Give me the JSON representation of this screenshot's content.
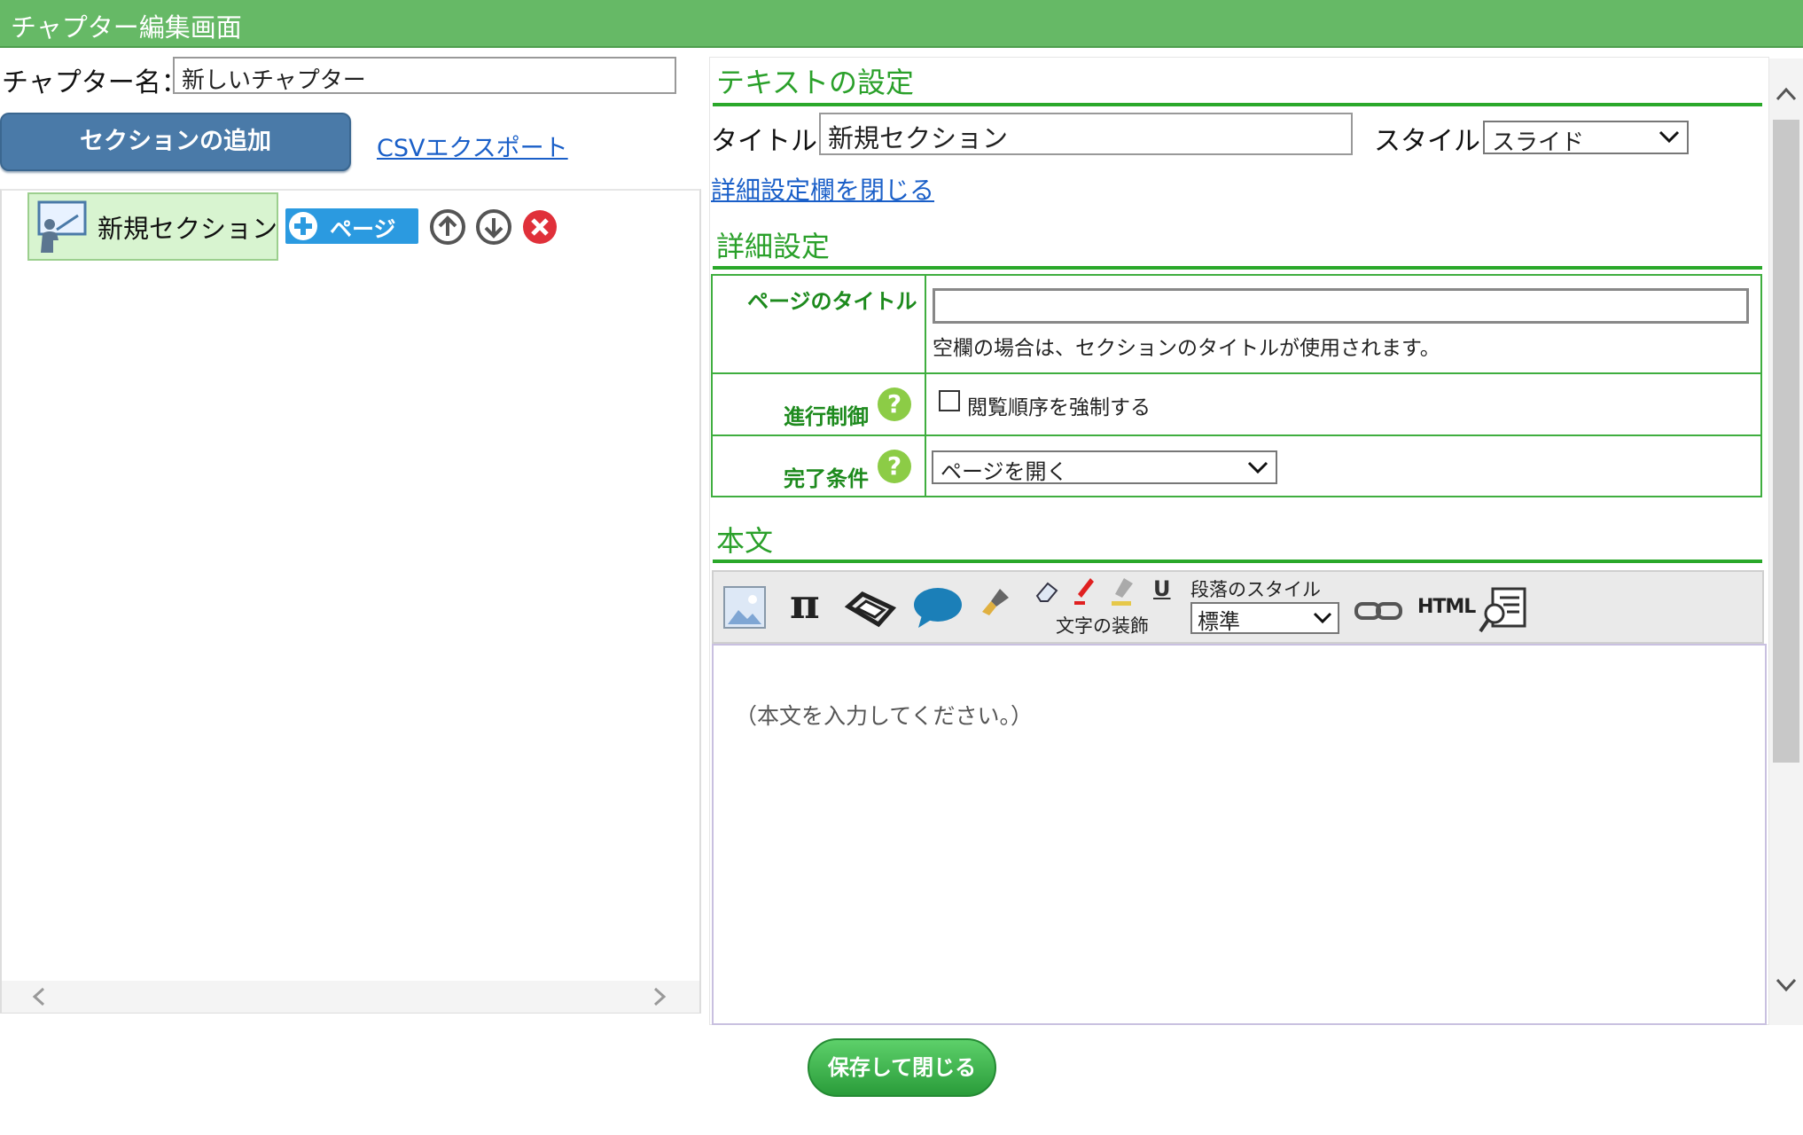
{
  "window": {
    "title": "チャプター編集画面"
  },
  "chapter": {
    "name_label": "チャプター名：",
    "name_value": "新しいチャプター"
  },
  "left": {
    "add_section_label": "セクションの追加",
    "csv_export_label": "CSVエクスポート",
    "tree": {
      "section_label": "新規セクション",
      "page_button_label": "ページ"
    }
  },
  "text_settings": {
    "heading": "テキストの設定",
    "title_label": "タイトル:",
    "title_value": "新規セクション",
    "style_label": "スタイル:",
    "style_value": "スライド",
    "collapse_link": "詳細設定欄を閉じる"
  },
  "detail": {
    "heading": "詳細設定",
    "page_title_label": "ページのタイトル",
    "page_title_value": "",
    "page_title_hint": "空欄の場合は、セクションのタイトルが使用されます。",
    "progress_label": "進行制御",
    "progress_checkbox_label": "閲覧順序を強制する",
    "progress_checked": false,
    "completion_label": "完了条件",
    "completion_value": "ページを開く",
    "help_glyph": "?"
  },
  "body": {
    "heading": "本文",
    "pi_glyph": "π",
    "underline_glyph": "U",
    "text_decoration_label": "文字の装飾",
    "paragraph_style_label": "段落のスタイル",
    "paragraph_style_value": "標準",
    "html_label": "HTML",
    "placeholder": "（本文を入力してください。）"
  },
  "footer": {
    "save_close_label": "保存して閉じる"
  },
  "colors": {
    "titlebar": "#66b966",
    "accent_green": "#2aa02a",
    "add_button": "#4a7aa8",
    "page_button": "#2b9ae0",
    "delete": "#e0303a"
  }
}
